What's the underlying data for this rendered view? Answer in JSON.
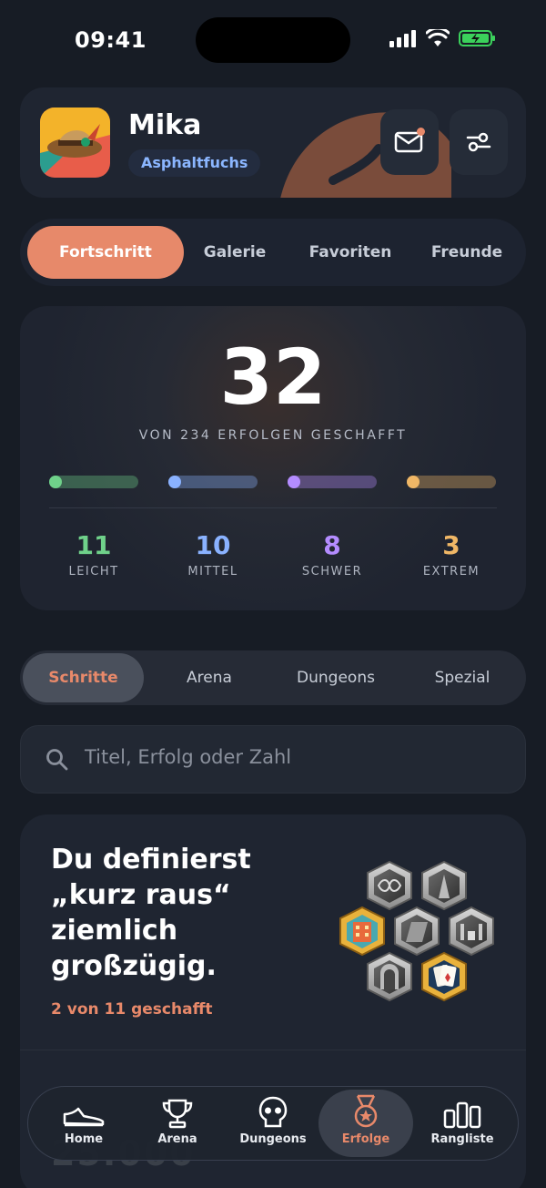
{
  "status_bar": {
    "time": "09:41"
  },
  "profile": {
    "name": "Mika",
    "badge": "Asphaltfuchs"
  },
  "top_tabs": [
    "Fortschritt",
    "Galerie",
    "Favoriten",
    "Freunde"
  ],
  "stats": {
    "total": "32",
    "caption": "VON 234 ERFOLGEN GESCHAFFT",
    "levels": [
      {
        "value": "11",
        "label": "LEICHT",
        "color": "#6fd18a",
        "progress": 0.05
      },
      {
        "value": "10",
        "label": "MITTEL",
        "color": "#8ab2ff",
        "progress": 0.05
      },
      {
        "value": "8",
        "label": "SCHWER",
        "color": "#b48cff",
        "progress": 0.05
      },
      {
        "value": "3",
        "label": "EXTREM",
        "color": "#f0b766",
        "progress": 0.05
      }
    ]
  },
  "categories": [
    "Schritte",
    "Arena",
    "Dungeons",
    "Spezial"
  ],
  "search": {
    "placeholder": "Titel, Erfolg oder Zahl"
  },
  "achievement_group": {
    "title": "Du definierst „kurz raus“ ziemlich großzügig.",
    "progress": "2 von 11 geschafft"
  },
  "ghost": {
    "number": "25.000"
  },
  "nav": [
    {
      "label": "Home",
      "icon": "shoe-icon"
    },
    {
      "label": "Arena",
      "icon": "trophy-icon"
    },
    {
      "label": "Dungeons",
      "icon": "skull-icon"
    },
    {
      "label": "Erfolge",
      "icon": "medal-icon"
    },
    {
      "label": "Rangliste",
      "icon": "bars-icon"
    }
  ],
  "colors": {
    "accent": "#e7896a",
    "background": "#171c25"
  }
}
